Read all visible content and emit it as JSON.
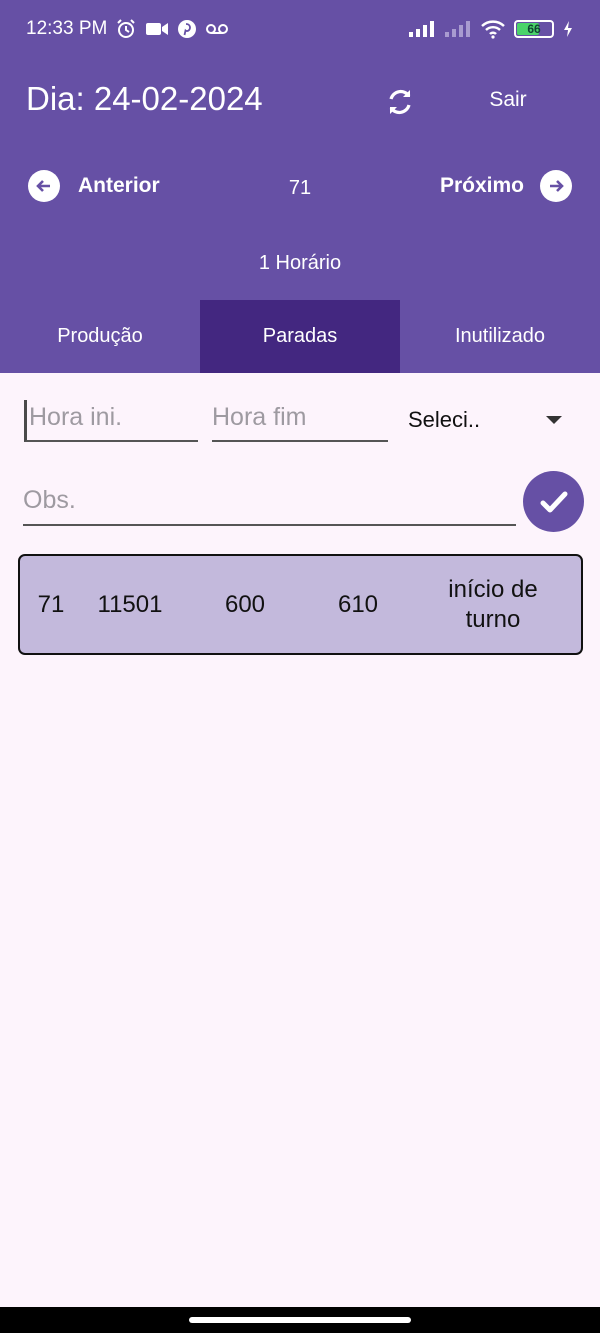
{
  "status_bar": {
    "time": "12:33 PM",
    "battery_level": "66",
    "icons_left": [
      "alarm-icon",
      "video-icon",
      "pinterest-icon",
      "voicemail-icon"
    ],
    "icons_right": [
      "signal-icon",
      "signal-off-icon",
      "wifi-icon",
      "battery-icon",
      "charging-icon"
    ]
  },
  "header": {
    "title": "Dia: 24-02-2024",
    "exit_label": "Sair",
    "sync_icon": "sync-icon"
  },
  "navigation": {
    "prev_label": "Anterior",
    "count": "71",
    "next_label": "Próximo"
  },
  "schedule_label": "1 Horário",
  "tabs": [
    {
      "label": "Produção",
      "active": false
    },
    {
      "label": "Paradas",
      "active": true
    },
    {
      "label": "Inutilizado",
      "active": false
    }
  ],
  "form": {
    "hora_ini_placeholder": "Hora ini.",
    "hora_fim_placeholder": "Hora fim",
    "select_value": "Seleci..",
    "obs_placeholder": "Obs."
  },
  "records": [
    {
      "col1": "71",
      "col2": "11501",
      "col3": "600",
      "col4": "610",
      "col5": "início de turno"
    }
  ],
  "colors": {
    "primary": "#6650a5",
    "active_tab": "#432780",
    "background": "#fdf4fc",
    "record_bg": "#c3b9dc"
  }
}
